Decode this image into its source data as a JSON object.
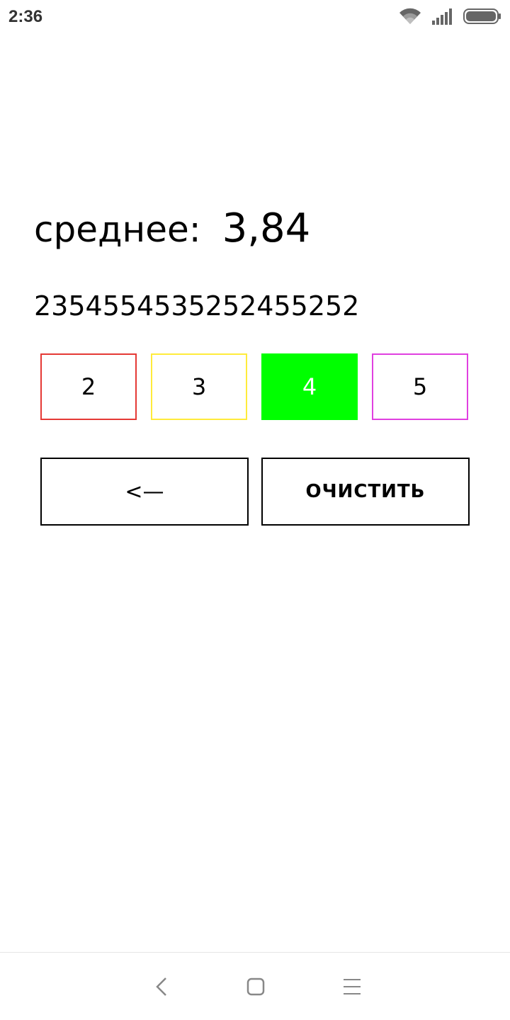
{
  "status_bar": {
    "time": "2:36",
    "icons": [
      "wifi-icon",
      "signal-icon",
      "battery-icon"
    ]
  },
  "average": {
    "label": "среднее:",
    "value": "3,84"
  },
  "grades_string": "2354554535252455252",
  "grade_buttons": [
    {
      "label": "2",
      "border_color": "#e53935",
      "selected": false
    },
    {
      "label": "3",
      "border_color": "#ffeb3b",
      "selected": false
    },
    {
      "label": "4",
      "border_color": "#00ff00",
      "selected": true
    },
    {
      "label": "5",
      "border_color": "#e040e0",
      "selected": false
    }
  ],
  "actions": {
    "backspace_label": "<—",
    "clear_label": "ОЧИСТИТЬ"
  },
  "nav_bar": {
    "icons": [
      "back-icon",
      "home-icon",
      "menu-icon"
    ]
  }
}
